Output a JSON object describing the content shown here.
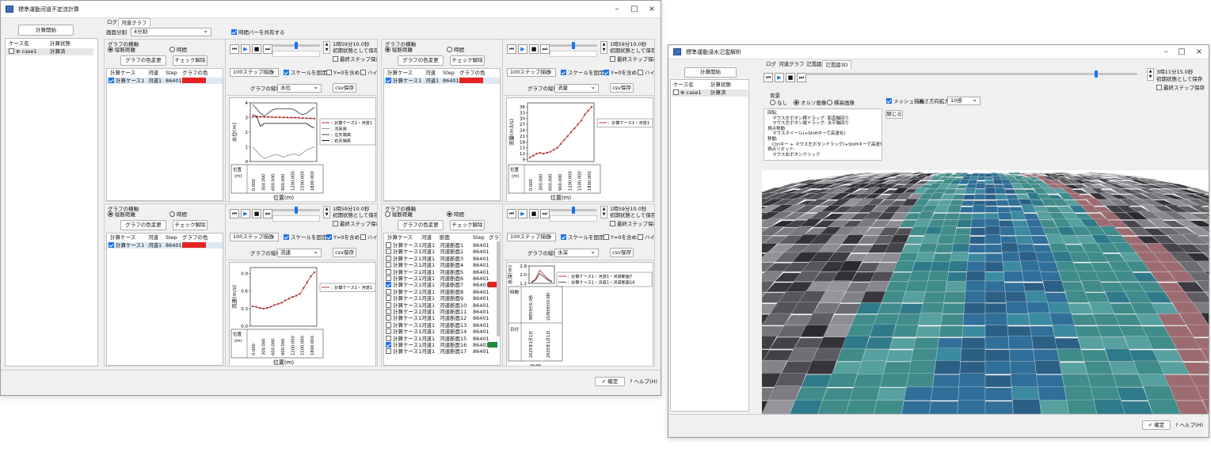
{
  "left_window": {
    "title": "標準運動河道不定流計算",
    "start_button": "計算開始",
    "case_table": {
      "headers": [
        "ケース名",
        "計算状態"
      ],
      "rows": [
        {
          "name": "case1",
          "state": "計算済"
        }
      ]
    },
    "tabs": [
      "ログ",
      "河道グラフ"
    ],
    "split_label": "画面分割",
    "split_value": "4分割",
    "share_time_bar": "時間バーを共有する",
    "ok_button": "確定",
    "help_button": "ヘルプ(H)",
    "panels": [
      {
        "axis_group": "グラフの横軸",
        "axis_opt1": "縦断距離",
        "axis_opt2": "時間",
        "axis_selected": "1",
        "color_btn": "グラフの色変更",
        "uncheck_btn": "チェック解除",
        "headers": [
          "計算ケース",
          "河道",
          "Step",
          "グラフの色"
        ],
        "rows": [
          {
            "name": "計算ケース1",
            "river": "河道1",
            "step": "86401",
            "color": "#e52222",
            "checked": true
          }
        ],
        "time_text": "1時59分10.0秒",
        "save_initial": "初期状態として保存",
        "final_step": "最終ステップ保存",
        "step_select": "100ステップ描画",
        "fix_scale": "スケールを固定",
        "include_zero": "Y=0を含める",
        "high": "ハイエト",
        "y_axis_label": "グラフの縦軸",
        "y_axis_value": "水位",
        "csv_btn": "csv保存",
        "chart_title_y": "水位(m)",
        "chart_x": "位置(m)",
        "table_label": "位置\n(m)",
        "legend": [
          "：計算ケース1・河道1",
          "：河床高",
          "：左天端高",
          "：右天端高"
        ]
      },
      {
        "axis_group": "グラフの横軸",
        "axis_opt1": "縦断距離",
        "axis_opt2": "時間",
        "axis_selected": "1",
        "color_btn": "グラフの色変更",
        "uncheck_btn": "チェック解除",
        "headers": [
          "計算ケース",
          "河道",
          "Step",
          "グラフの色"
        ],
        "rows": [
          {
            "name": "計算ケース1",
            "river": "河道1",
            "step": "86401",
            "color": "#e52222",
            "checked": true
          }
        ],
        "time_text": "1時59分10.0秒",
        "save_initial": "初期状態として保存",
        "final_step": "最終ステップ保存",
        "step_select": "100ステップ描画",
        "fix_scale": "スケールを固定",
        "include_zero": "Y=0を含める",
        "high": "ハイエト",
        "y_axis_label": "グラフの縦軸",
        "y_axis_value": "流量",
        "csv_btn": "csv保存",
        "chart_title_y": "流量(m3/s)",
        "chart_x": "位置(m)",
        "table_label": "位置\n(m)",
        "legend": [
          "：計算ケース1・河道1"
        ]
      },
      {
        "axis_group": "グラフの横軸",
        "axis_opt1": "縦断距離",
        "axis_opt2": "時間",
        "axis_selected": "1",
        "color_btn": "グラフの色変更",
        "uncheck_btn": "チェック解除",
        "headers": [
          "計算ケース",
          "河道",
          "Step",
          "グラフの色"
        ],
        "rows": [
          {
            "name": "計算ケース1",
            "river": "河道1",
            "step": "86401",
            "color": "#e52222",
            "checked": true
          }
        ],
        "time_text": "1時59分10.0秒",
        "save_initial": "初期状態として保存",
        "final_step": "最終ステップ保存",
        "step_select": "100ステップ描画",
        "fix_scale": "スケールを固定",
        "include_zero": "Y=0を含める",
        "high": "ハイエト",
        "y_axis_label": "グラフの縦軸",
        "y_axis_value": "流速",
        "csv_btn": "csv保存",
        "chart_title_y": "流速(m/s)",
        "chart_x": "位置(m)",
        "table_label": "位置\n(m)",
        "legend": [
          "：計算ケース1・河道1"
        ]
      },
      {
        "axis_group": "グラフの横軸",
        "axis_opt1": "縦断距離",
        "axis_opt2": "時間",
        "axis_selected": "2",
        "color_btn": "グラフの色変更",
        "uncheck_btn": "チェック解除",
        "headers": [
          "計算ケース",
          "河道",
          "断面",
          "Step",
          "グラフ"
        ],
        "rows": [
          {
            "name": "計算ケース1",
            "river": "河道1",
            "sec": "河道断面1",
            "step": "86401",
            "color": "",
            "checked": false
          },
          {
            "name": "計算ケース1",
            "river": "河道1",
            "sec": "河道断面2",
            "step": "86401",
            "color": "",
            "checked": false
          },
          {
            "name": "計算ケース1",
            "river": "河道1",
            "sec": "河道断面3",
            "step": "86401",
            "color": "",
            "checked": false
          },
          {
            "name": "計算ケース1",
            "river": "河道1",
            "sec": "河道断面4",
            "step": "86401",
            "color": "",
            "checked": false
          },
          {
            "name": "計算ケース1",
            "river": "河道1",
            "sec": "河道断面5",
            "step": "86401",
            "color": "",
            "checked": false
          },
          {
            "name": "計算ケース1",
            "river": "河道1",
            "sec": "河道断面6",
            "step": "86401",
            "color": "",
            "checked": false
          },
          {
            "name": "計算ケース1",
            "river": "河道1",
            "sec": "河道断面7",
            "step": "86401",
            "color": "#e52222",
            "checked": true
          },
          {
            "name": "計算ケース1",
            "river": "河道1",
            "sec": "河道断面8",
            "step": "86401",
            "color": "",
            "checked": false
          },
          {
            "name": "計算ケース1",
            "river": "河道1",
            "sec": "河道断面9",
            "step": "86401",
            "color": "",
            "checked": false
          },
          {
            "name": "計算ケース1",
            "river": "河道1",
            "sec": "河道断面10",
            "step": "86401",
            "color": "",
            "checked": false
          },
          {
            "name": "計算ケース1",
            "river": "河道1",
            "sec": "河道断面11",
            "step": "86401",
            "color": "",
            "checked": false
          },
          {
            "name": "計算ケース1",
            "river": "河道1",
            "sec": "河道断面12",
            "step": "86401",
            "color": "",
            "checked": false
          },
          {
            "name": "計算ケース1",
            "river": "河道1",
            "sec": "河道断面13",
            "step": "86401",
            "color": "",
            "checked": false
          },
          {
            "name": "計算ケース1",
            "river": "河道1",
            "sec": "河道断面14",
            "step": "86401",
            "color": "",
            "checked": false
          },
          {
            "name": "計算ケース1",
            "river": "河道1",
            "sec": "河道断面15",
            "step": "86401",
            "color": "",
            "checked": false
          },
          {
            "name": "計算ケース1",
            "river": "河道1",
            "sec": "河道断面16",
            "step": "86401",
            "color": "#1e8a3c",
            "checked": true
          },
          {
            "name": "計算ケース1",
            "river": "河道1",
            "sec": "河道断面17",
            "step": "86401",
            "color": "",
            "checked": false
          }
        ],
        "time_text": "1時59分10.0秒",
        "save_initial": "初期状態として保存",
        "final_step": "最終ステップ保存",
        "step_select": "100ステップ描画",
        "fix_scale": "スケールを固定",
        "include_zero": "Y=0を含める",
        "high": "ハイエト",
        "y_axis_label": "グラフの縦軸",
        "y_axis_value": "水深",
        "csv_btn": "csv保存",
        "chart_title_y": "水深(m)",
        "chart_x": "時間",
        "table_label1": "時間",
        "table_label2": "日付",
        "legend": [
          "：計算ケース1・河道1・河道断面7",
          "：計算ケース1・河道1・河道断面16"
        ],
        "time_ticks": [
          "3時59分0.0秒",
          "21時59分0.0秒"
        ],
        "date_ticks": [
          "2025年1月1日",
          "2025年1月1日"
        ]
      }
    ]
  },
  "right_window": {
    "title": "標準運動浸水氾濫解析",
    "start_button": "計算開始",
    "case_table": {
      "headers": [
        "ケース名",
        "計算状態"
      ],
      "rows": [
        {
          "name": "case1",
          "state": "計算済"
        }
      ]
    },
    "tabs": [
      "ログ",
      "河道グラフ",
      "氾濫図",
      "氾濫図3D"
    ],
    "time_text": "3時11分15.0秒",
    "save_initial": "初期状態として保存",
    "final_step": "最終ステップ保存",
    "bg_group": "背景",
    "bg_opt1": "なし",
    "bg_opt2": "オルソ画像",
    "bg_opt3": "標高画像",
    "mesh_draw": "メッシュ描画",
    "height_zoom_label": "高さ方向拡大",
    "height_zoom_value": "10倍",
    "close_button": "閉じる",
    "help_lines": [
      "回転:",
      "マウス左ボタン横ドラッグ: 鉛直軸回り",
      "マウス左ボタン縦ドラッグ: 水平軸回り",
      "視点移動:",
      "マウスホイール(+Shiftキーで高速化)",
      "移動:",
      "Ctrlキー + マウス左ボタンドラッグ(+Shiftキーで高速化)",
      "視点リセット:",
      "マウス右ボタンクリック"
    ],
    "ok_button": "確定",
    "help_button": "ヘルプ(H)"
  },
  "chart_data": [
    {
      "type": "line",
      "ylabel": "水位(m)",
      "xlabel": "位置(m)",
      "x": [
        0,
        300000,
        600000,
        900000,
        1200000,
        1500000,
        1800000
      ],
      "x_tick_labels": [
        "0.000",
        "300.000",
        "600.000",
        "900.000",
        "1200.000",
        "1500.000",
        "1800.000"
      ],
      "ylim": [
        0,
        4
      ],
      "y_ticks": [
        0,
        1,
        2,
        3,
        4
      ],
      "series": [
        {
          "name": "計算ケース1・河道1",
          "color": "#b22222",
          "values": [
            3.05,
            3.05,
            3.05,
            3.04,
            3.04,
            3.03,
            3.02,
            3.02,
            3.01,
            3.0,
            3.0,
            2.99,
            2.98,
            2.97,
            2.96,
            2.95,
            2.93
          ]
        },
        {
          "name": "河床高",
          "color": "#888888",
          "values": [
            1.0,
            0.7,
            0.4,
            0.2,
            0.3,
            0.4,
            0.5,
            0.4,
            0.3,
            0.4,
            0.5,
            0.5,
            0.4,
            0.6,
            0.8,
            0.9,
            1.0
          ]
        },
        {
          "name": "左天端高",
          "color": "#333333",
          "values": [
            3.9,
            3.6,
            3.3,
            3.1,
            3.3,
            3.5,
            3.6,
            3.6,
            3.6,
            3.6,
            3.6,
            3.5,
            3.3,
            3.2,
            3.3,
            3.5,
            3.7
          ]
        },
        {
          "name": "右天端高",
          "color": "#000000",
          "values": [
            3.2,
            3.1,
            2.4,
            2.6,
            2.6,
            2.6,
            2.6,
            2.6,
            2.6,
            2.6,
            2.6,
            2.6,
            2.6,
            2.6,
            2.6,
            2.4,
            2.3
          ]
        }
      ]
    },
    {
      "type": "line",
      "ylabel": "流量(m3/s)",
      "xlabel": "位置(m)",
      "x_tick_labels": [
        "0.000",
        "300.000",
        "600.000",
        "900.000",
        "1200.000",
        "1500.000",
        "1800.000"
      ],
      "ylim": [
        8,
        38
      ],
      "y_ticks": [
        9,
        12,
        15,
        18,
        21,
        24,
        27,
        30,
        33,
        36
      ],
      "series": [
        {
          "name": "計算ケース1・河道1",
          "color": "#b22222",
          "values": [
            10,
            11,
            12,
            12.5,
            12,
            12.5,
            13,
            14,
            15,
            17,
            19,
            21,
            23,
            25,
            27,
            29,
            32,
            34,
            36
          ]
        }
      ]
    },
    {
      "type": "line",
      "ylabel": "流速(m/s)",
      "xlabel": "位置(m)",
      "x_tick_labels": [
        "0.000",
        "300.000",
        "600.000",
        "900.000",
        "1200.000",
        "1500.000",
        "1800.000"
      ],
      "ylim": [
        0,
        1.0
      ],
      "y_ticks": [
        0.0,
        0.3,
        0.6,
        0.9
      ],
      "series": [
        {
          "name": "計算ケース1・河道1",
          "color": "#b22222",
          "values": [
            0.34,
            0.33,
            0.31,
            0.3,
            0.31,
            0.33,
            0.36,
            0.38,
            0.4,
            0.44,
            0.47,
            0.5,
            0.52,
            0.55,
            0.65,
            0.75,
            0.85,
            0.92
          ]
        }
      ]
    },
    {
      "type": "line",
      "ylabel": "水深(m)",
      "xlabel": "時間",
      "ylim": [
        1.2,
        2.8
      ],
      "y_ticks": [
        1.2,
        2.0,
        2.8
      ],
      "series": [
        {
          "name": "計算ケース1・河道1・河道断面7",
          "color": "#b22222",
          "values": [
            1.3,
            1.6,
            2.4,
            2.0,
            1.6,
            1.4
          ]
        },
        {
          "name": "計算ケース1・河道1・河道断面16",
          "color": "#444444",
          "values": [
            1.25,
            1.5,
            2.1,
            1.8,
            1.5,
            1.3
          ]
        }
      ]
    }
  ]
}
